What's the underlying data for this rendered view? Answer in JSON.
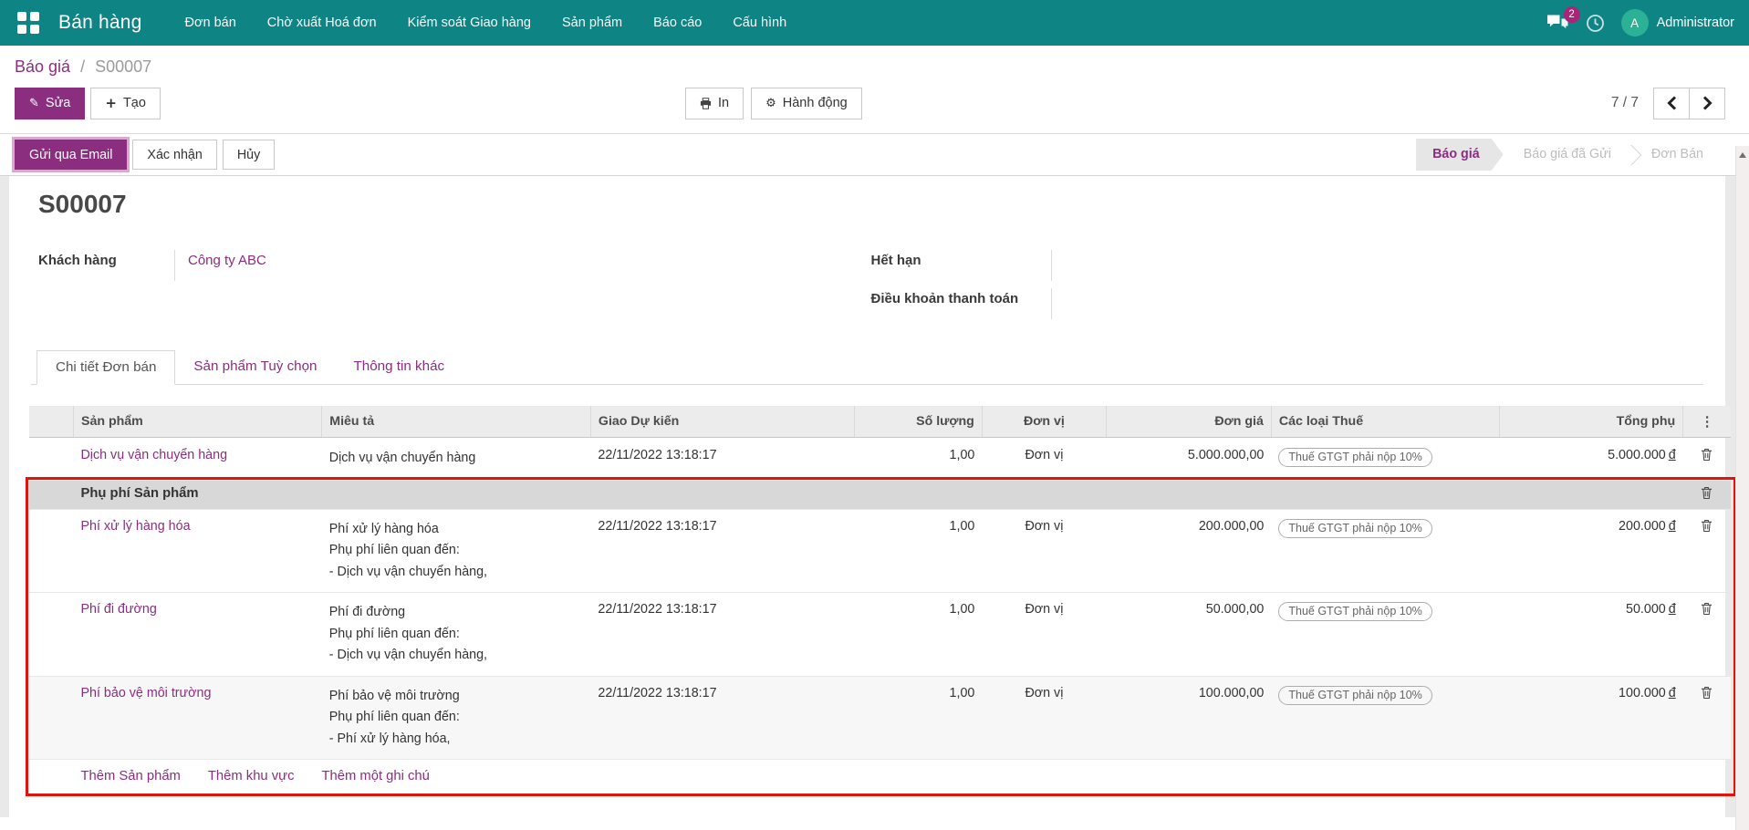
{
  "navbar": {
    "brand": "Bán hàng",
    "items": [
      {
        "label": "Đơn bán"
      },
      {
        "label": "Chờ xuất Hoá đơn"
      },
      {
        "label": "Kiểm soát Giao hàng"
      },
      {
        "label": "Sản phẩm"
      },
      {
        "label": "Báo cáo"
      },
      {
        "label": "Cấu hình"
      }
    ],
    "messages_badge": "2",
    "user_initial": "A",
    "user_name": "Administrator"
  },
  "breadcrumb": {
    "parent": "Báo giá",
    "separator": "/",
    "current": "S00007"
  },
  "toolbar": {
    "edit": "Sửa",
    "create": "Tạo",
    "print": "In",
    "action": "Hành động",
    "pager": "7 / 7"
  },
  "statusbar": {
    "buttons": [
      {
        "label": "Gửi qua Email"
      },
      {
        "label": "Xác nhận"
      },
      {
        "label": "Hủy"
      }
    ],
    "steps": [
      {
        "label": "Báo giá",
        "active": true
      },
      {
        "label": "Báo giá đã Gửi",
        "active": false
      },
      {
        "label": "Đơn Bán",
        "active": false
      }
    ]
  },
  "form": {
    "title": "S00007",
    "customer_label": "Khách hàng",
    "customer_value": "Công ty ABC",
    "expiry_label": "Hết hạn",
    "expiry_value": "",
    "payment_terms_label": "Điều khoản thanh toán",
    "payment_terms_value": ""
  },
  "tabs": [
    {
      "label": "Chi tiết Đơn bán",
      "active": true
    },
    {
      "label": "Sản phẩm Tuỳ chọn",
      "active": false
    },
    {
      "label": "Thông tin khác",
      "active": false
    }
  ],
  "table": {
    "headers": [
      "Sản phẩm",
      "Miêu tả",
      "Giao Dự kiến",
      "Số lượng",
      "Đơn vị",
      "Đơn giá",
      "Các loại Thuế",
      "Tổng phụ"
    ],
    "rows": [
      {
        "type": "product",
        "product": "Dịch vụ vận chuyển hàng",
        "desc": [
          "Dịch vụ vận chuyển hàng"
        ],
        "date": "22/11/2022 13:18:17",
        "qty": "1,00",
        "uom": "Đơn vị",
        "price": "5.000.000,00",
        "tax": "Thuế GTGT phải nộp 10%",
        "subtotal": "5.000.000",
        "currency": "đ"
      },
      {
        "type": "section",
        "label": "Phụ phí Sản phẩm"
      },
      {
        "type": "product",
        "product": "Phí xử lý hàng hóa",
        "desc": [
          "Phí xử lý hàng hóa",
          "Phụ phí liên quan đến:",
          "- Dịch vụ vận chuyển hàng,"
        ],
        "date": "22/11/2022 13:18:17",
        "qty": "1,00",
        "uom": "Đơn vị",
        "price": "200.000,00",
        "tax": "Thuế GTGT phải nộp 10%",
        "subtotal": "200.000",
        "currency": "đ"
      },
      {
        "type": "product",
        "product": "Phí đi đường",
        "desc": [
          "Phí đi đường",
          "Phụ phí liên quan đến:",
          "- Dịch vụ vận chuyển hàng,"
        ],
        "date": "22/11/2022 13:18:17",
        "qty": "1,00",
        "uom": "Đơn vị",
        "price": "50.000,00",
        "tax": "Thuế GTGT phải nộp 10%",
        "subtotal": "50.000",
        "currency": "đ"
      },
      {
        "type": "product",
        "product": "Phí bảo vệ môi trường",
        "desc": [
          "Phí bảo vệ môi trường",
          "Phụ phí liên quan đến:",
          "- Phí xử lý hàng hóa,"
        ],
        "date": "22/11/2022 13:18:17",
        "qty": "1,00",
        "uom": "Đơn vị",
        "price": "100.000,00",
        "tax": "Thuế GTGT phải nộp 10%",
        "subtotal": "100.000",
        "currency": "đ"
      }
    ],
    "footer_links": [
      "Thêm Sản phẩm",
      "Thêm khu vực",
      "Thêm một ghi chú"
    ]
  },
  "icons": {
    "apps_menu": "grid-of-squares",
    "edit": "✎",
    "create": "+",
    "print": "printer-icon",
    "action": "⚙",
    "messages": "chat-bubbles-icon",
    "activities": "clock-icon",
    "column_options": "⋮",
    "delete_row": "trash-icon",
    "pager_prev": "chevron-left",
    "pager_next": "chevron-right",
    "scroll_up": "triangle-up"
  },
  "colors": {
    "navbar_teal": "#0e8484",
    "primary_purple": "#8b2e7f",
    "link_purple": "#8b2e7f",
    "badge_magenta": "#ad2379",
    "avatar_green": "#2bb195",
    "annotation_red": "#e3120b",
    "section_row_gray": "#d8d8d8",
    "header_row_gray": "#ececec"
  }
}
